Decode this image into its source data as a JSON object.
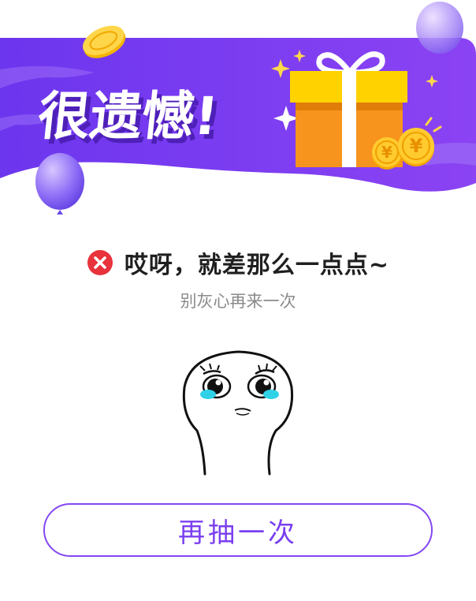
{
  "banner": {
    "title": "很遗憾!",
    "coin_symbol": "¥"
  },
  "message": {
    "headline": "哎呀，就差那么一点点~",
    "subline": "别灰心再来一次"
  },
  "actions": {
    "retry_label": "再抽一次"
  },
  "icons": {
    "status": "close-circle-icon",
    "mascot": "crying-face-illustration"
  },
  "colors": {
    "banner_purple": "#7b3cf0",
    "accent_purple": "#8347f2",
    "error_red": "#e8323c",
    "gift_orange": "#f7941d",
    "gift_yellow": "#ffd200",
    "coin_gold": "#f7c221"
  }
}
